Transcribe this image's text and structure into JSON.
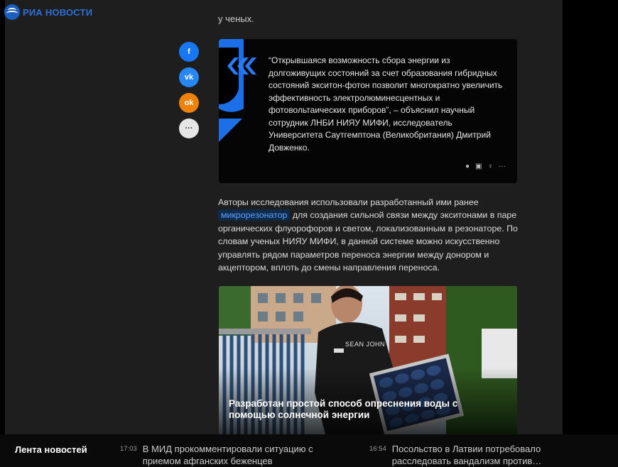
{
  "header": {
    "logo_text": "РИА НОВОСТИ"
  },
  "article": {
    "cut_text": "у ченых.",
    "share": [
      {
        "icon": "facebook-icon",
        "label": "f",
        "color": "#1877f2"
      },
      {
        "icon": "vk-icon",
        "label": "vk",
        "color": "#2787f5"
      },
      {
        "icon": "odnoklassniki-icon",
        "label": "ok",
        "color": "#ee8208"
      },
      {
        "icon": "more-icon",
        "label": "···",
        "color": "#e6e6e6"
      }
    ],
    "quote": {
      "text": "“Открывшаяся возможность сбора энергии из долгоживущих состояний за счет образования гибридных состояний экситон-фотон позволит многократно увеличить эффективность электролюминесцентных и фотовольтаических приборов”, – объяснил научный сотрудник ЛНБИ НИЯУ МИФИ, исследователь Университета Саутгемптона (Великобритания) Дмитрий Довженко.",
      "actions": [
        "f",
        "vk",
        "ok",
        "···"
      ]
    },
    "paragraph": {
      "before": "Авторы исследования использовали разработанный ими ранее ",
      "link": "микрорезонатор",
      "after": " для создания сильной связи между экситонами в паре органических флуорофоров и светом, локализованным в резонаторе. По словам ученых НИЯУ МИФИ, в данной системе можно искусственно управлять рядом параметров переноса энергии между донором и акцептором, вплоть до смены направления переноса."
    },
    "related": {
      "title": "Разработан простой способ опреснения воды с помощью солнечной энергии",
      "shirt_text": "SEAN JOHN"
    }
  },
  "feed": {
    "title": "Лента новостей",
    "items": [
      {
        "time": "17:03",
        "text": "В МИД прокомментировали ситуацию с приемом афганских беженцев"
      },
      {
        "time": "16:54",
        "text": "Посольство в Латвии потребовало расследовать вандализм против…"
      }
    ]
  }
}
